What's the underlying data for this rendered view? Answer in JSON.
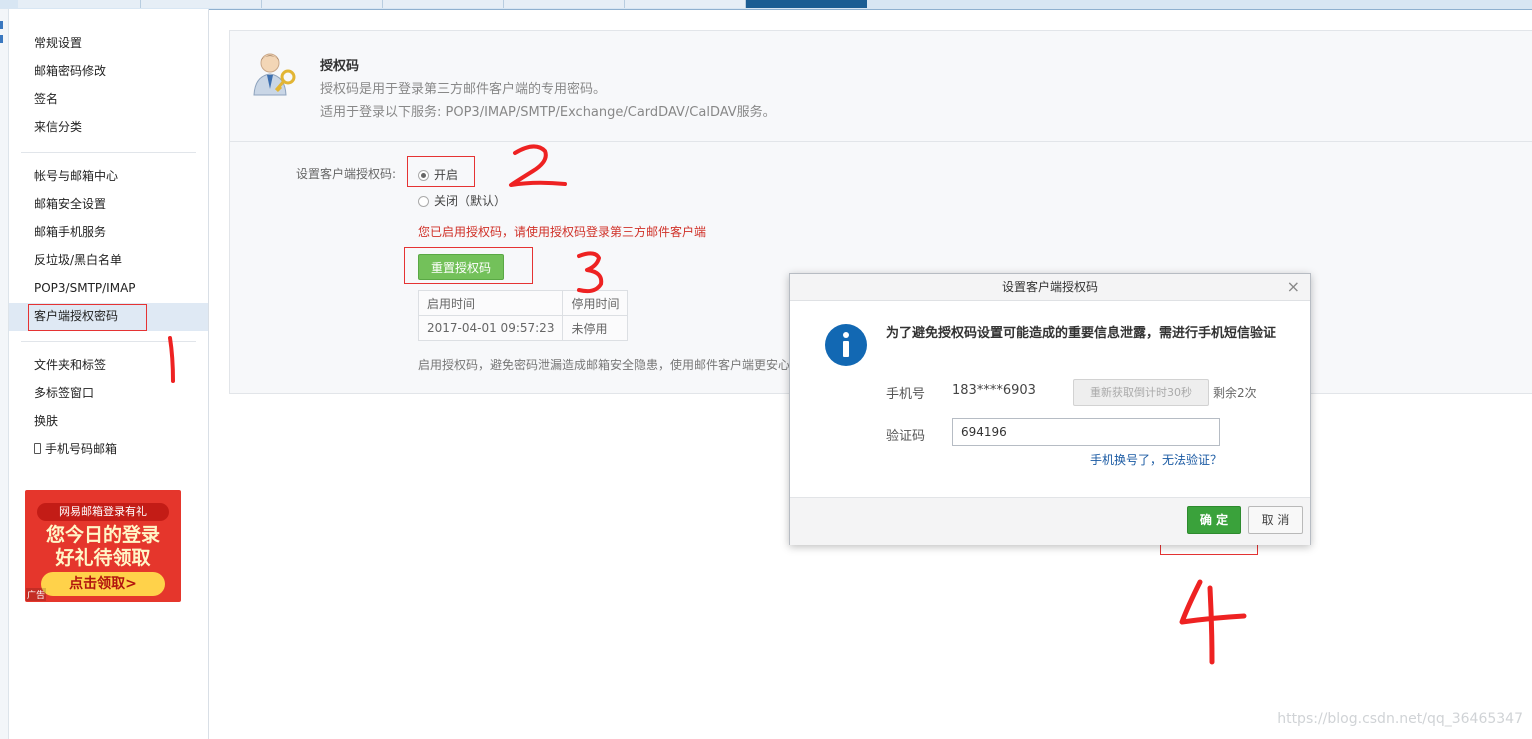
{
  "sidebar": {
    "items": [
      {
        "label": "常规设置"
      },
      {
        "label": "邮箱密码修改"
      },
      {
        "label": "签名"
      },
      {
        "label": "来信分类"
      },
      {
        "label": "帐号与邮箱中心"
      },
      {
        "label": "邮箱安全设置"
      },
      {
        "label": "邮箱手机服务"
      },
      {
        "label": "反垃圾/黑白名单"
      },
      {
        "label": "POP3/SMTP/IMAP"
      },
      {
        "label": "客户端授权密码",
        "selected": true
      },
      {
        "label": "文件夹和标签"
      },
      {
        "label": "多标签窗口"
      },
      {
        "label": "换肤"
      },
      {
        "label": "手机号码邮箱",
        "icon": "phone-icon"
      }
    ]
  },
  "ad": {
    "header": "网易邮箱登录有礼",
    "line1": "您今日的登录",
    "line2": "好礼待领取",
    "button": "点击领取>",
    "tag": "广告"
  },
  "panel": {
    "title": "授权码",
    "desc1": "授权码是用于登录第三方邮件客户端的专用密码。",
    "desc2": "适用于登录以下服务: POP3/IMAP/SMTP/Exchange/CardDAV/CalDAV服务。",
    "setting_label": "设置客户端授权码:",
    "option_on": "开启",
    "option_off": "关闭（默认）",
    "selected_option": "开启",
    "enabled_notice": "您已启用授权码，请使用授权码登录第三方邮件客户端",
    "reset_button": "重置授权码",
    "table": {
      "headers": [
        "启用时间",
        "停用时间"
      ],
      "rows": [
        [
          "2017-04-01 09:57:23",
          "未停用"
        ]
      ]
    },
    "tip": "启用授权码，避免密码泄漏造成邮箱安全隐患，使用邮件客户端更安心"
  },
  "dialog": {
    "title": "设置客户端授权码",
    "close": "×",
    "message": "为了避免授权码设置可能造成的重要信息泄露，需进行手机短信验证",
    "phone_label": "手机号",
    "phone_value": "183****6903",
    "resend_button": "重新获取倒计时30秒",
    "remaining": "剩余2次",
    "code_label": "验证码",
    "code_value": "694196",
    "help_link": "手机换号了，无法验证？",
    "ok_button": "确 定",
    "cancel_button": "取 消"
  },
  "watermark": "https://blog.csdn.net/qq_36465347",
  "colors": {
    "annotation": "#e53333",
    "primary_green": "#3aa23b",
    "notice_red": "#d03128",
    "link_blue": "#1a5aa3"
  }
}
